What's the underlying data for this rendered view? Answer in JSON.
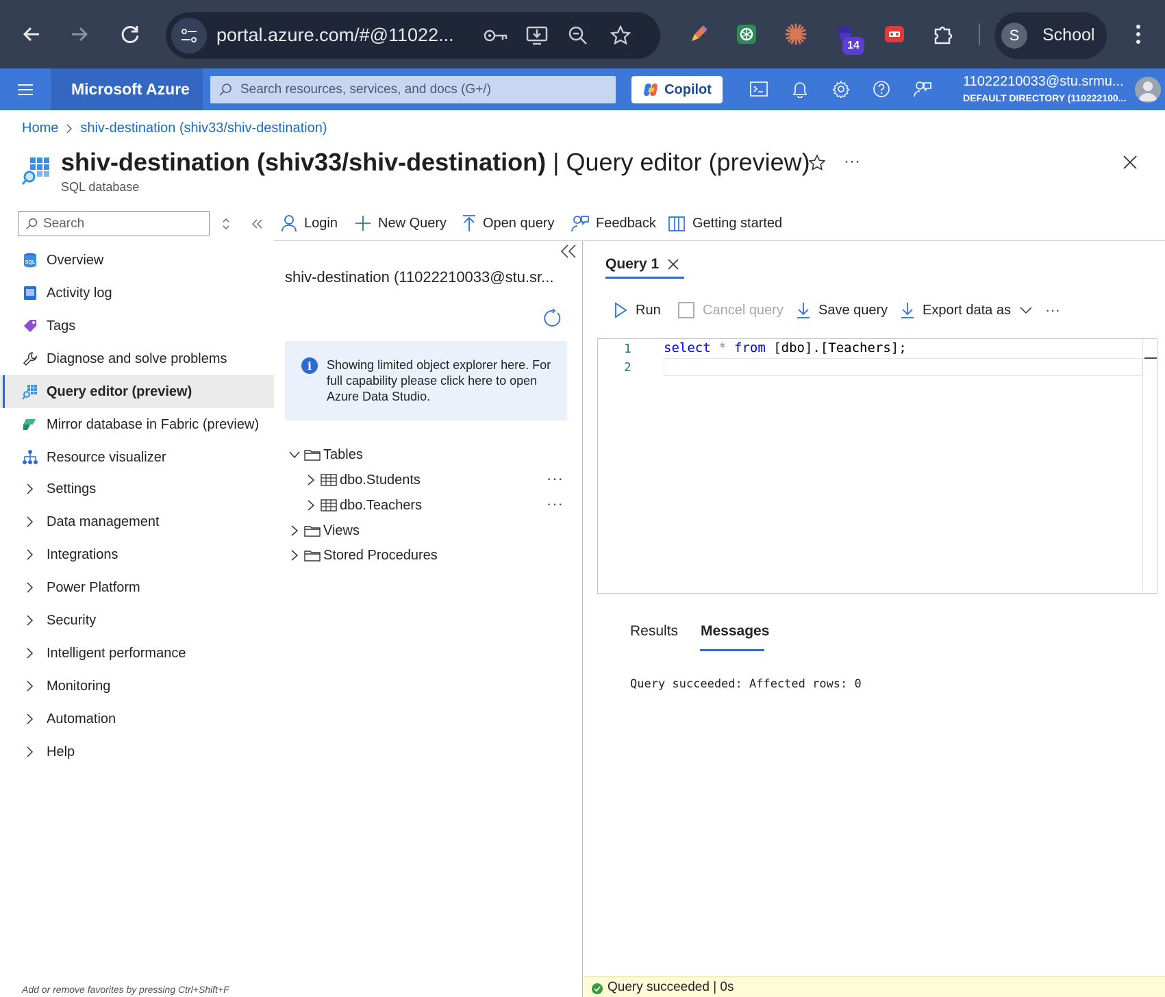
{
  "browser": {
    "url": "portal.azure.com/#@11022...",
    "extension_badge": "14",
    "profile_initial": "S",
    "profile_name": "School"
  },
  "azure": {
    "brand": "Microsoft Azure",
    "search_placeholder": "Search resources, services, and docs (G+/)",
    "copilot_label": "Copilot",
    "account_name": "11022210033@stu.srmu...",
    "account_directory": "DEFAULT DIRECTORY (110222100..."
  },
  "breadcrumb": {
    "home": "Home",
    "current": "shiv-destination (shiv33/shiv-destination)"
  },
  "page": {
    "title_resource": "shiv-destination (shiv33/shiv-destination)",
    "title_blade": " | Query editor (preview)",
    "subtitle": "SQL database",
    "more": "···"
  },
  "nav": {
    "search_placeholder": "Search",
    "items": [
      {
        "label": "Overview",
        "icon": "sql-database-icon"
      },
      {
        "label": "Activity log",
        "icon": "activity-log-icon"
      },
      {
        "label": "Tags",
        "icon": "tag-icon"
      },
      {
        "label": "Diagnose and solve problems",
        "icon": "wrench-icon"
      },
      {
        "label": "Query editor (preview)",
        "icon": "query-editor-icon",
        "active": true
      },
      {
        "label": "Mirror database in Fabric (preview)",
        "icon": "fabric-icon"
      },
      {
        "label": "Resource visualizer",
        "icon": "hierarchy-icon"
      },
      {
        "label": "Settings",
        "icon": "chevron-right-icon"
      },
      {
        "label": "Data management",
        "icon": "chevron-right-icon"
      },
      {
        "label": "Integrations",
        "icon": "chevron-right-icon"
      },
      {
        "label": "Power Platform",
        "icon": "chevron-right-icon"
      },
      {
        "label": "Security",
        "icon": "chevron-right-icon"
      },
      {
        "label": "Intelligent performance",
        "icon": "chevron-right-icon"
      },
      {
        "label": "Monitoring",
        "icon": "chevron-right-icon"
      },
      {
        "label": "Automation",
        "icon": "chevron-right-icon"
      },
      {
        "label": "Help",
        "icon": "chevron-right-icon"
      }
    ],
    "footer": "Add or remove favorites by pressing Ctrl+Shift+F"
  },
  "toolbar": {
    "login": "Login",
    "new_query": "New Query",
    "open_query": "Open query",
    "feedback": "Feedback",
    "getting_started": "Getting started"
  },
  "explorer": {
    "connection": "shiv-destination (11022210033@stu.sr...",
    "info": "Showing limited object explorer here. For full capability please click here to open Azure Data Studio.",
    "tree": {
      "tables": "Tables",
      "students": "dbo.Students",
      "teachers": "dbo.Teachers",
      "views": "Views",
      "procedures": "Stored Procedures"
    },
    "row_more": "···"
  },
  "editor": {
    "tab_label": "Query 1",
    "run": "Run",
    "cancel": "Cancel query",
    "save": "Save query",
    "export": "Export data as",
    "more": "···",
    "line_numbers": [
      "1",
      "2"
    ],
    "code": {
      "select": "select",
      "star": "*",
      "from": "from",
      "object": "[dbo].[Teachers];"
    }
  },
  "results": {
    "tab_results": "Results",
    "tab_messages": "Messages",
    "message": "Query succeeded: Affected rows: 0"
  },
  "status": {
    "text": "Query succeeded | 0s"
  },
  "colors": {
    "azure_blue": "#3d78d8",
    "brand_dark": "#3467c2",
    "chrome_bg": "#353f54",
    "link": "#1a6dc2",
    "success_green": "#3a9b3a"
  }
}
